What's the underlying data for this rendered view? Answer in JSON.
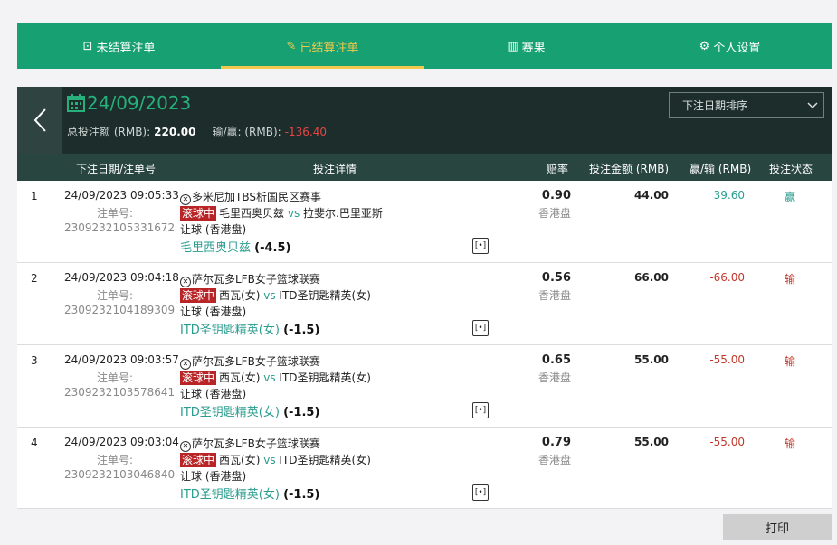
{
  "tabs": [
    {
      "icon": "⊡",
      "label": "未结算注单"
    },
    {
      "icon": "✎",
      "label": "已结算注单"
    },
    {
      "icon": "▥",
      "label": "赛果"
    },
    {
      "icon": "⚙",
      "label": "个人设置"
    }
  ],
  "header": {
    "date": "24/09/2023",
    "total_label": "总投注额 (RMB):",
    "total_value": "220.00",
    "winloss_label": "输/赢: (RMB):",
    "winloss_value": "-136.40",
    "sort_selected": "下注日期排序"
  },
  "columns": {
    "date": "下注日期/注单号",
    "details": "投注详情",
    "odds": "赔率",
    "stake": "投注金额 (RMB)",
    "winloss": "赢/输 (RMB)",
    "status": "投注状态"
  },
  "bets": [
    {
      "index": "1",
      "datetime": "24/09/2023 09:05:33",
      "order_label": "注单号:",
      "order_no": "2309232105331672",
      "league": "多米尼加TBS析国民区赛事",
      "live": "滚球中",
      "home": "毛里西奥贝兹",
      "vs": "vs",
      "away": "拉斐尔.巴里亚斯",
      "market": "让球 (香港盘)",
      "selection": "毛里西奥贝兹",
      "handicap": "(-4.5)",
      "odds": "0.90",
      "odds_type": "香港盘",
      "stake": "44.00",
      "winloss": "39.60",
      "status": "赢"
    },
    {
      "index": "2",
      "datetime": "24/09/2023 09:04:18",
      "order_label": "注单号:",
      "order_no": "2309232104189309",
      "league": "萨尔瓦多LFB女子篮球联赛",
      "live": "滚球中",
      "home": "西瓦(女)",
      "vs": "vs",
      "away": "ITD圣钥匙精英(女)",
      "market": "让球 (香港盘)",
      "selection": "ITD圣钥匙精英(女)",
      "handicap": "(-1.5)",
      "odds": "0.56",
      "odds_type": "香港盘",
      "stake": "66.00",
      "winloss": "-66.00",
      "status": "输"
    },
    {
      "index": "3",
      "datetime": "24/09/2023 09:03:57",
      "order_label": "注单号:",
      "order_no": "2309232103578641",
      "league": "萨尔瓦多LFB女子篮球联赛",
      "live": "滚球中",
      "home": "西瓦(女)",
      "vs": "vs",
      "away": "ITD圣钥匙精英(女)",
      "market": "让球 (香港盘)",
      "selection": "ITD圣钥匙精英(女)",
      "handicap": "(-1.5)",
      "odds": "0.65",
      "odds_type": "香港盘",
      "stake": "55.00",
      "winloss": "-55.00",
      "status": "输"
    },
    {
      "index": "4",
      "datetime": "24/09/2023 09:03:04",
      "order_label": "注单号:",
      "order_no": "2309232103046840",
      "league": "萨尔瓦多LFB女子篮球联赛",
      "live": "滚球中",
      "home": "西瓦(女)",
      "vs": "vs",
      "away": "ITD圣钥匙精英(女)",
      "market": "让球 (香港盘)",
      "selection": "ITD圣钥匙精英(女)",
      "handicap": "(-1.5)",
      "odds": "0.79",
      "odds_type": "香港盘",
      "stake": "55.00",
      "winloss": "-55.00",
      "status": "输"
    }
  ],
  "print_label": "打印",
  "colors": {
    "green": "#17a072",
    "dark": "#1c2d2b",
    "accent": "#f2c94c",
    "live": "#b92426",
    "win": "#2a9d8f",
    "lose": "#c0392b"
  }
}
